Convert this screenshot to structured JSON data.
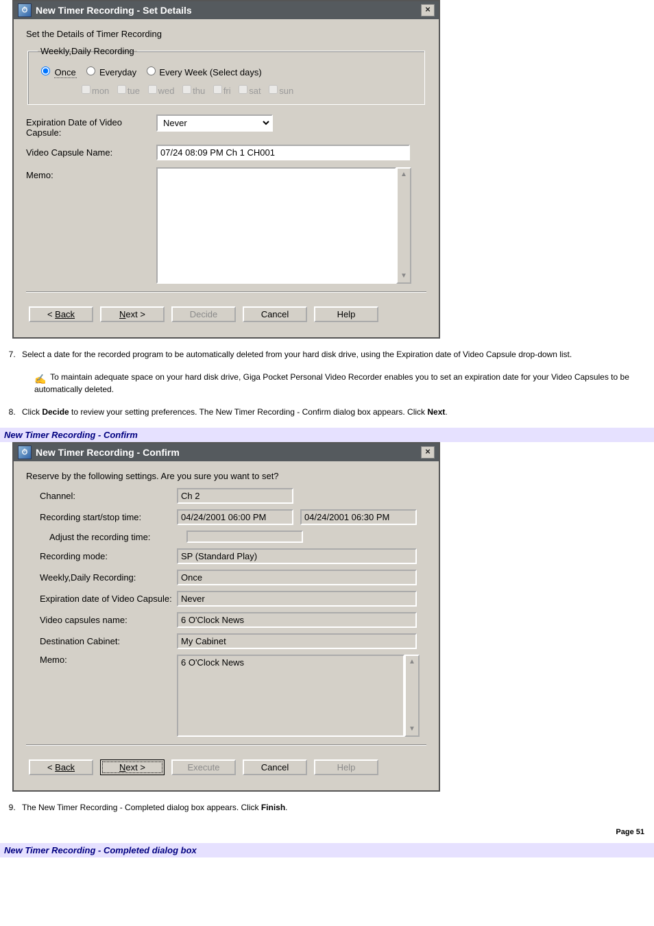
{
  "dialog1": {
    "title": "New Timer Recording - Set Details",
    "instruction": "Set the Details of Timer Recording",
    "group_legend": "Weekly,Daily Recording",
    "radio_once": "Once",
    "radio_everyday": "Everyday",
    "radio_selectdays": "Every Week (Select days)",
    "days": [
      "mon",
      "tue",
      "wed",
      "thu",
      "fri",
      "sat",
      "sun"
    ],
    "exp_label": "Expiration Date of Video Capsule:",
    "exp_value": "Never",
    "name_label": "Video Capsule Name:",
    "name_value": "07/24 08:09 PM Ch 1 CH001",
    "memo_label": "Memo:",
    "buttons": {
      "back": "Back",
      "next": "Next >",
      "decide": "Decide",
      "cancel": "Cancel",
      "help": "Help"
    }
  },
  "step7": {
    "text": "Select a date for the recorded program to be automatically deleted from your hard disk drive, using the Expiration date of Video Capsule drop-down list."
  },
  "note7": {
    "text": "To maintain adequate space on your hard disk drive, Giga Pocket Personal Video Recorder enables you to set an expiration date for your Video Capsules to be automatically deleted."
  },
  "step8": {
    "pre": "Click ",
    "bold1": "Decide",
    "mid": " to review your setting preferences. The New Timer Recording - Confirm dialog box appears. Click ",
    "bold2": "Next",
    "post": "."
  },
  "caption2": "New Timer Recording - Confirm",
  "dialog2": {
    "title": "New Timer Recording - Confirm",
    "instruction": "Reserve by the following settings. Are you sure you want to set?",
    "rows": {
      "channel_label": "Channel:",
      "channel_value": "Ch 2",
      "startstop_label": "Recording start/stop time:",
      "start_value": "04/24/2001 06:00 PM",
      "stop_value": "04/24/2001 06:30 PM",
      "adjust_label": "Adjust the recording time:",
      "adjust_value": "",
      "mode_label": "Recording mode:",
      "mode_value": "SP (Standard Play)",
      "weekly_label": "Weekly,Daily Recording:",
      "weekly_value": "Once",
      "exp_label": "Expiration date of Video Capsule:",
      "exp_value": "Never",
      "capname_label": "Video capsules name:",
      "capname_value": "6 O'Clock News",
      "dest_label": "Destination Cabinet:",
      "dest_value": "My Cabinet",
      "memo_label": "Memo:",
      "memo_value": "6 O'Clock News"
    },
    "buttons": {
      "back": "Back",
      "next": "Next >",
      "execute": "Execute",
      "cancel": "Cancel",
      "help": "Help"
    }
  },
  "step9": {
    "pre": "The New Timer Recording - Completed dialog box appears. Click ",
    "bold": "Finish",
    "post": "."
  },
  "caption3": "New Timer Recording - Completed dialog box",
  "page_footer": "Page 51"
}
